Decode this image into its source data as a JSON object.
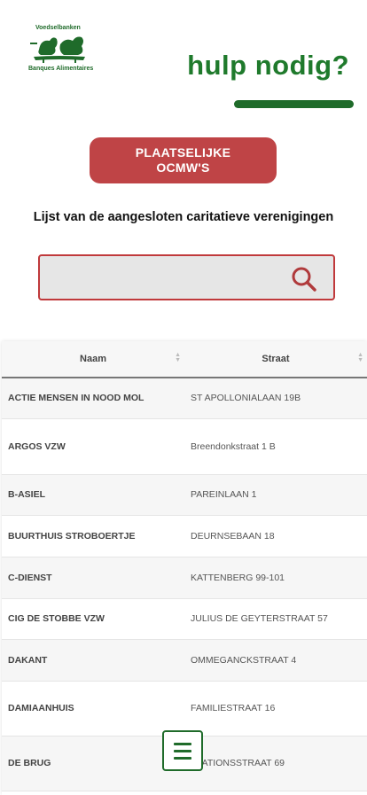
{
  "logo": {
    "top_text": "Voedselbanken",
    "bottom_text": "Banques Alimentaires"
  },
  "header": {
    "headline": "hulp nodig?"
  },
  "ocmw_button": {
    "label": "PLAATSELIJKE OCMW'S"
  },
  "subtitle": "Lijst van de aangesloten caritatieve verenigingen",
  "search": {
    "value": "",
    "placeholder": "",
    "icon": "search-icon"
  },
  "table": {
    "columns": [
      "Naam",
      "Straat"
    ],
    "rows": [
      {
        "naam": "ACTIE MENSEN IN NOOD MOL",
        "straat": "ST APOLLONIALAAN 19B"
      },
      {
        "naam": "ARGOS VZW",
        "straat": "Breendonkstraat 1 B"
      },
      {
        "naam": "B-ASIEL",
        "straat": "PAREINLAAN 1"
      },
      {
        "naam": "BUURTHUIS STROBOERTJE",
        "straat": "DEURNSEBAAN 18"
      },
      {
        "naam": "C-DIENST",
        "straat": "KATTENBERG 99-101"
      },
      {
        "naam": "CIG DE STOBBE VZW",
        "straat": "JULIUS DE GEYTERSTRAAT 57"
      },
      {
        "naam": "DAKANT",
        "straat": "OMMEGANCKSTRAAT 4"
      },
      {
        "naam": "DAMIAANHUIS",
        "straat": "FAMILIESTRAAT 16"
      },
      {
        "naam": "DE BRUG",
        "straat": "STATIONSSTRAAT 69"
      }
    ]
  },
  "menu_button": {
    "icon": "hamburger-menu-icon"
  },
  "colors": {
    "brand_green": "#1f6b2a",
    "accent_red": "#bf4446"
  }
}
